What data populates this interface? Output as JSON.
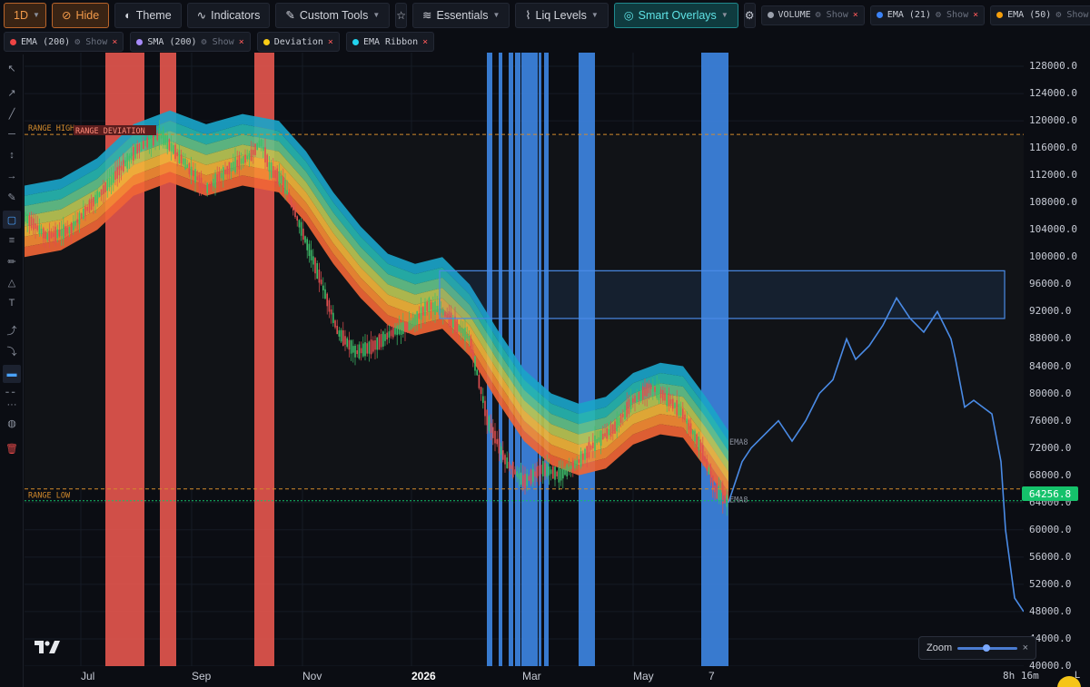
{
  "toolbar": {
    "timeframe": "1D",
    "hide": "Hide",
    "theme": "Theme",
    "indicators": "Indicators",
    "custom_tools": "Custom Tools",
    "essentials": "Essentials",
    "liq_levels": "Liq Levels",
    "smart_overlays": "Smart Overlays"
  },
  "indicator_chips_row1": [
    {
      "name": "VOLUME",
      "show": "Show",
      "color": "#9aa0ab"
    },
    {
      "name": "EMA (21)",
      "show": "Show",
      "color": "#3b82f6"
    },
    {
      "name": "EMA (50)",
      "show": "Show",
      "color": "#f59e0b"
    }
  ],
  "indicator_chips_row2": [
    {
      "name": "EMA (200)",
      "show": "Show",
      "color": "#ef4444"
    },
    {
      "name": "SMA (200)",
      "show": "Show",
      "color": "#a78bfa"
    },
    {
      "name": "Deviation",
      "show": "",
      "color": "#facc15"
    },
    {
      "name": "EMA Ribbon",
      "show": "",
      "color": "#22d3ee"
    }
  ],
  "chart_labels": {
    "range_high": "RANGE HIGH",
    "range_low": "RANGE LOW",
    "range_deviation": "RANGE DEVIATION",
    "ema8_upper": "EMA8",
    "ema8_lower": "EMA8",
    "current_price": "64256.8"
  },
  "price_axis": [
    "128000.0",
    "124000.0",
    "120000.0",
    "116000.0",
    "112000.0",
    "108000.0",
    "104000.0",
    "100000.0",
    "96000.0",
    "92000.0",
    "88000.0",
    "84000.0",
    "80000.0",
    "76000.0",
    "72000.0",
    "68000.0",
    "64000.0",
    "60000.0",
    "56000.0",
    "52000.0",
    "48000.0",
    "44000.0",
    "40000.0"
  ],
  "time_axis": [
    "Jul",
    "Sep",
    "Nov",
    "2026",
    "Mar",
    "May",
    "7"
  ],
  "footer": {
    "countdown": "8h 16m",
    "scale_mode": "L"
  },
  "zoom": {
    "label": "Zoom",
    "level": 0.45
  },
  "chart_data": {
    "type": "line",
    "title": "",
    "ylim": [
      40000,
      130000
    ],
    "range_high": 118000,
    "range_low": 66000,
    "current_price": 64256.8,
    "price_path": [
      [
        0,
        106000
      ],
      [
        25,
        103000
      ],
      [
        50,
        104000
      ],
      [
        75,
        108000
      ],
      [
        100,
        112000
      ],
      [
        125,
        116000
      ],
      [
        150,
        118000
      ],
      [
        175,
        114000
      ],
      [
        200,
        110000
      ],
      [
        225,
        113000
      ],
      [
        250,
        115000
      ],
      [
        260,
        117000
      ],
      [
        270,
        113000
      ],
      [
        285,
        111000
      ],
      [
        305,
        104000
      ],
      [
        325,
        97000
      ],
      [
        345,
        89000
      ],
      [
        365,
        86000
      ],
      [
        385,
        87000
      ],
      [
        405,
        89000
      ],
      [
        425,
        90000
      ],
      [
        445,
        93000
      ],
      [
        460,
        92000
      ],
      [
        475,
        90000
      ],
      [
        490,
        88000
      ],
      [
        510,
        76000
      ],
      [
        530,
        70000
      ],
      [
        550,
        67000
      ],
      [
        570,
        69000
      ],
      [
        590,
        68000
      ],
      [
        610,
        70000
      ],
      [
        630,
        73000
      ],
      [
        650,
        75000
      ],
      [
        670,
        79000
      ],
      [
        690,
        81000
      ],
      [
        710,
        79000
      ],
      [
        725,
        77000
      ],
      [
        745,
        72000
      ],
      [
        760,
        66000
      ],
      [
        775,
        64000
      ]
    ],
    "forecast_path": [
      [
        775,
        64000
      ],
      [
        790,
        70000
      ],
      [
        800,
        72000
      ],
      [
        815,
        74000
      ],
      [
        830,
        76000
      ],
      [
        845,
        73000
      ],
      [
        860,
        76000
      ],
      [
        875,
        80000
      ],
      [
        890,
        82000
      ],
      [
        905,
        88000
      ],
      [
        915,
        85000
      ],
      [
        930,
        87000
      ],
      [
        945,
        90000
      ],
      [
        960,
        94000
      ],
      [
        975,
        91000
      ],
      [
        990,
        89000
      ],
      [
        1005,
        92000
      ],
      [
        1020,
        88000
      ],
      [
        1025,
        85000
      ],
      [
        1035,
        78000
      ],
      [
        1045,
        79000
      ],
      [
        1055,
        78000
      ],
      [
        1065,
        77000
      ],
      [
        1075,
        70000
      ],
      [
        1080,
        60000
      ],
      [
        1090,
        50000
      ],
      [
        1100,
        48000
      ]
    ]
  }
}
